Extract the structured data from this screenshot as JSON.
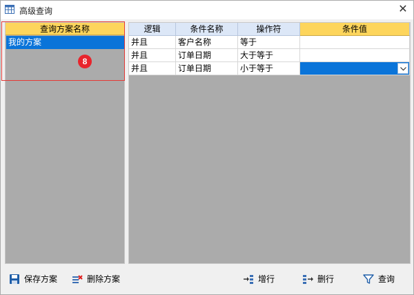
{
  "window": {
    "title": "高级查询",
    "close_glyph": "✕"
  },
  "schemes": {
    "header": "查询方案名称",
    "items": [
      "我的方案"
    ],
    "badge": "8"
  },
  "grid": {
    "columns": [
      "逻辑",
      "条件名称",
      "操作符",
      "条件值"
    ],
    "rows": [
      [
        "并且",
        "客户名称",
        "等于",
        ""
      ],
      [
        "并且",
        "订单日期",
        "大于等于",
        ""
      ],
      [
        "并且",
        "订单日期",
        "小于等于",
        ""
      ]
    ]
  },
  "toolbar": {
    "save": "保存方案",
    "delete": "删除方案",
    "add_row": "增行",
    "delete_row": "删行",
    "query": "查询"
  },
  "colors": {
    "header_active": "#fdd55c",
    "header": "#dce7f7",
    "selection": "#0a74d9",
    "panel_bg": "#ababab",
    "frame": "#e53935"
  }
}
